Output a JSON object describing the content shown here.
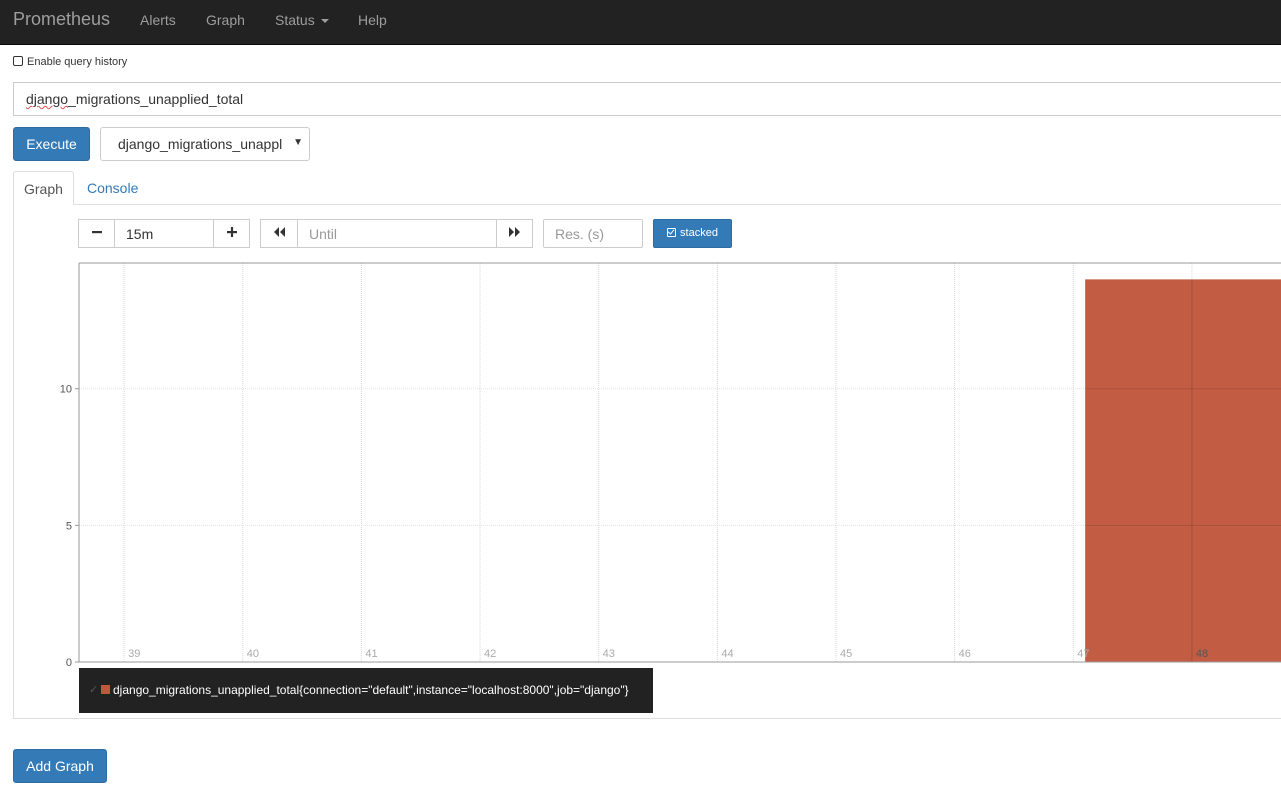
{
  "navbar": {
    "brand": "Prometheus",
    "items": [
      {
        "label": "Alerts"
      },
      {
        "label": "Graph"
      },
      {
        "label": "Status"
      },
      {
        "label": "Help"
      }
    ]
  },
  "history_label": "Enable query history",
  "expression": {
    "value_head": "django",
    "value_tail": "_migrations_unapplied_total"
  },
  "execute_label": "Execute",
  "metric_select": {
    "selected": "django_migrations_unappl"
  },
  "tabs": [
    {
      "label": "Graph"
    },
    {
      "label": "Console"
    }
  ],
  "controls": {
    "range_value": "15m",
    "until_placeholder": "Until",
    "resolution_placeholder": "Res. (s)",
    "stacked_label": "stacked",
    "decrease_icon": "minus-icon",
    "increase_icon": "plus-icon",
    "back_icon": "backward-icon",
    "forward_icon": "forward-icon"
  },
  "chart_data": {
    "type": "area",
    "stacked": true,
    "grid": true,
    "x_ticks": [
      "39",
      "40",
      "41",
      "42",
      "43",
      "44",
      "45",
      "46",
      "47",
      "48"
    ],
    "y_ticks": [
      "0",
      "5",
      "10"
    ],
    "ylim": [
      0,
      14.6
    ],
    "series": [
      {
        "name": "django_migrations_unapplied_total{connection=\"default\",instance=\"localhost:8000\",job=\"django\"}",
        "color": "#c0583e",
        "points": [
          [
            47.1,
            14
          ],
          [
            48.8,
            14
          ]
        ]
      }
    ]
  },
  "add_graph_label": "Add Graph"
}
